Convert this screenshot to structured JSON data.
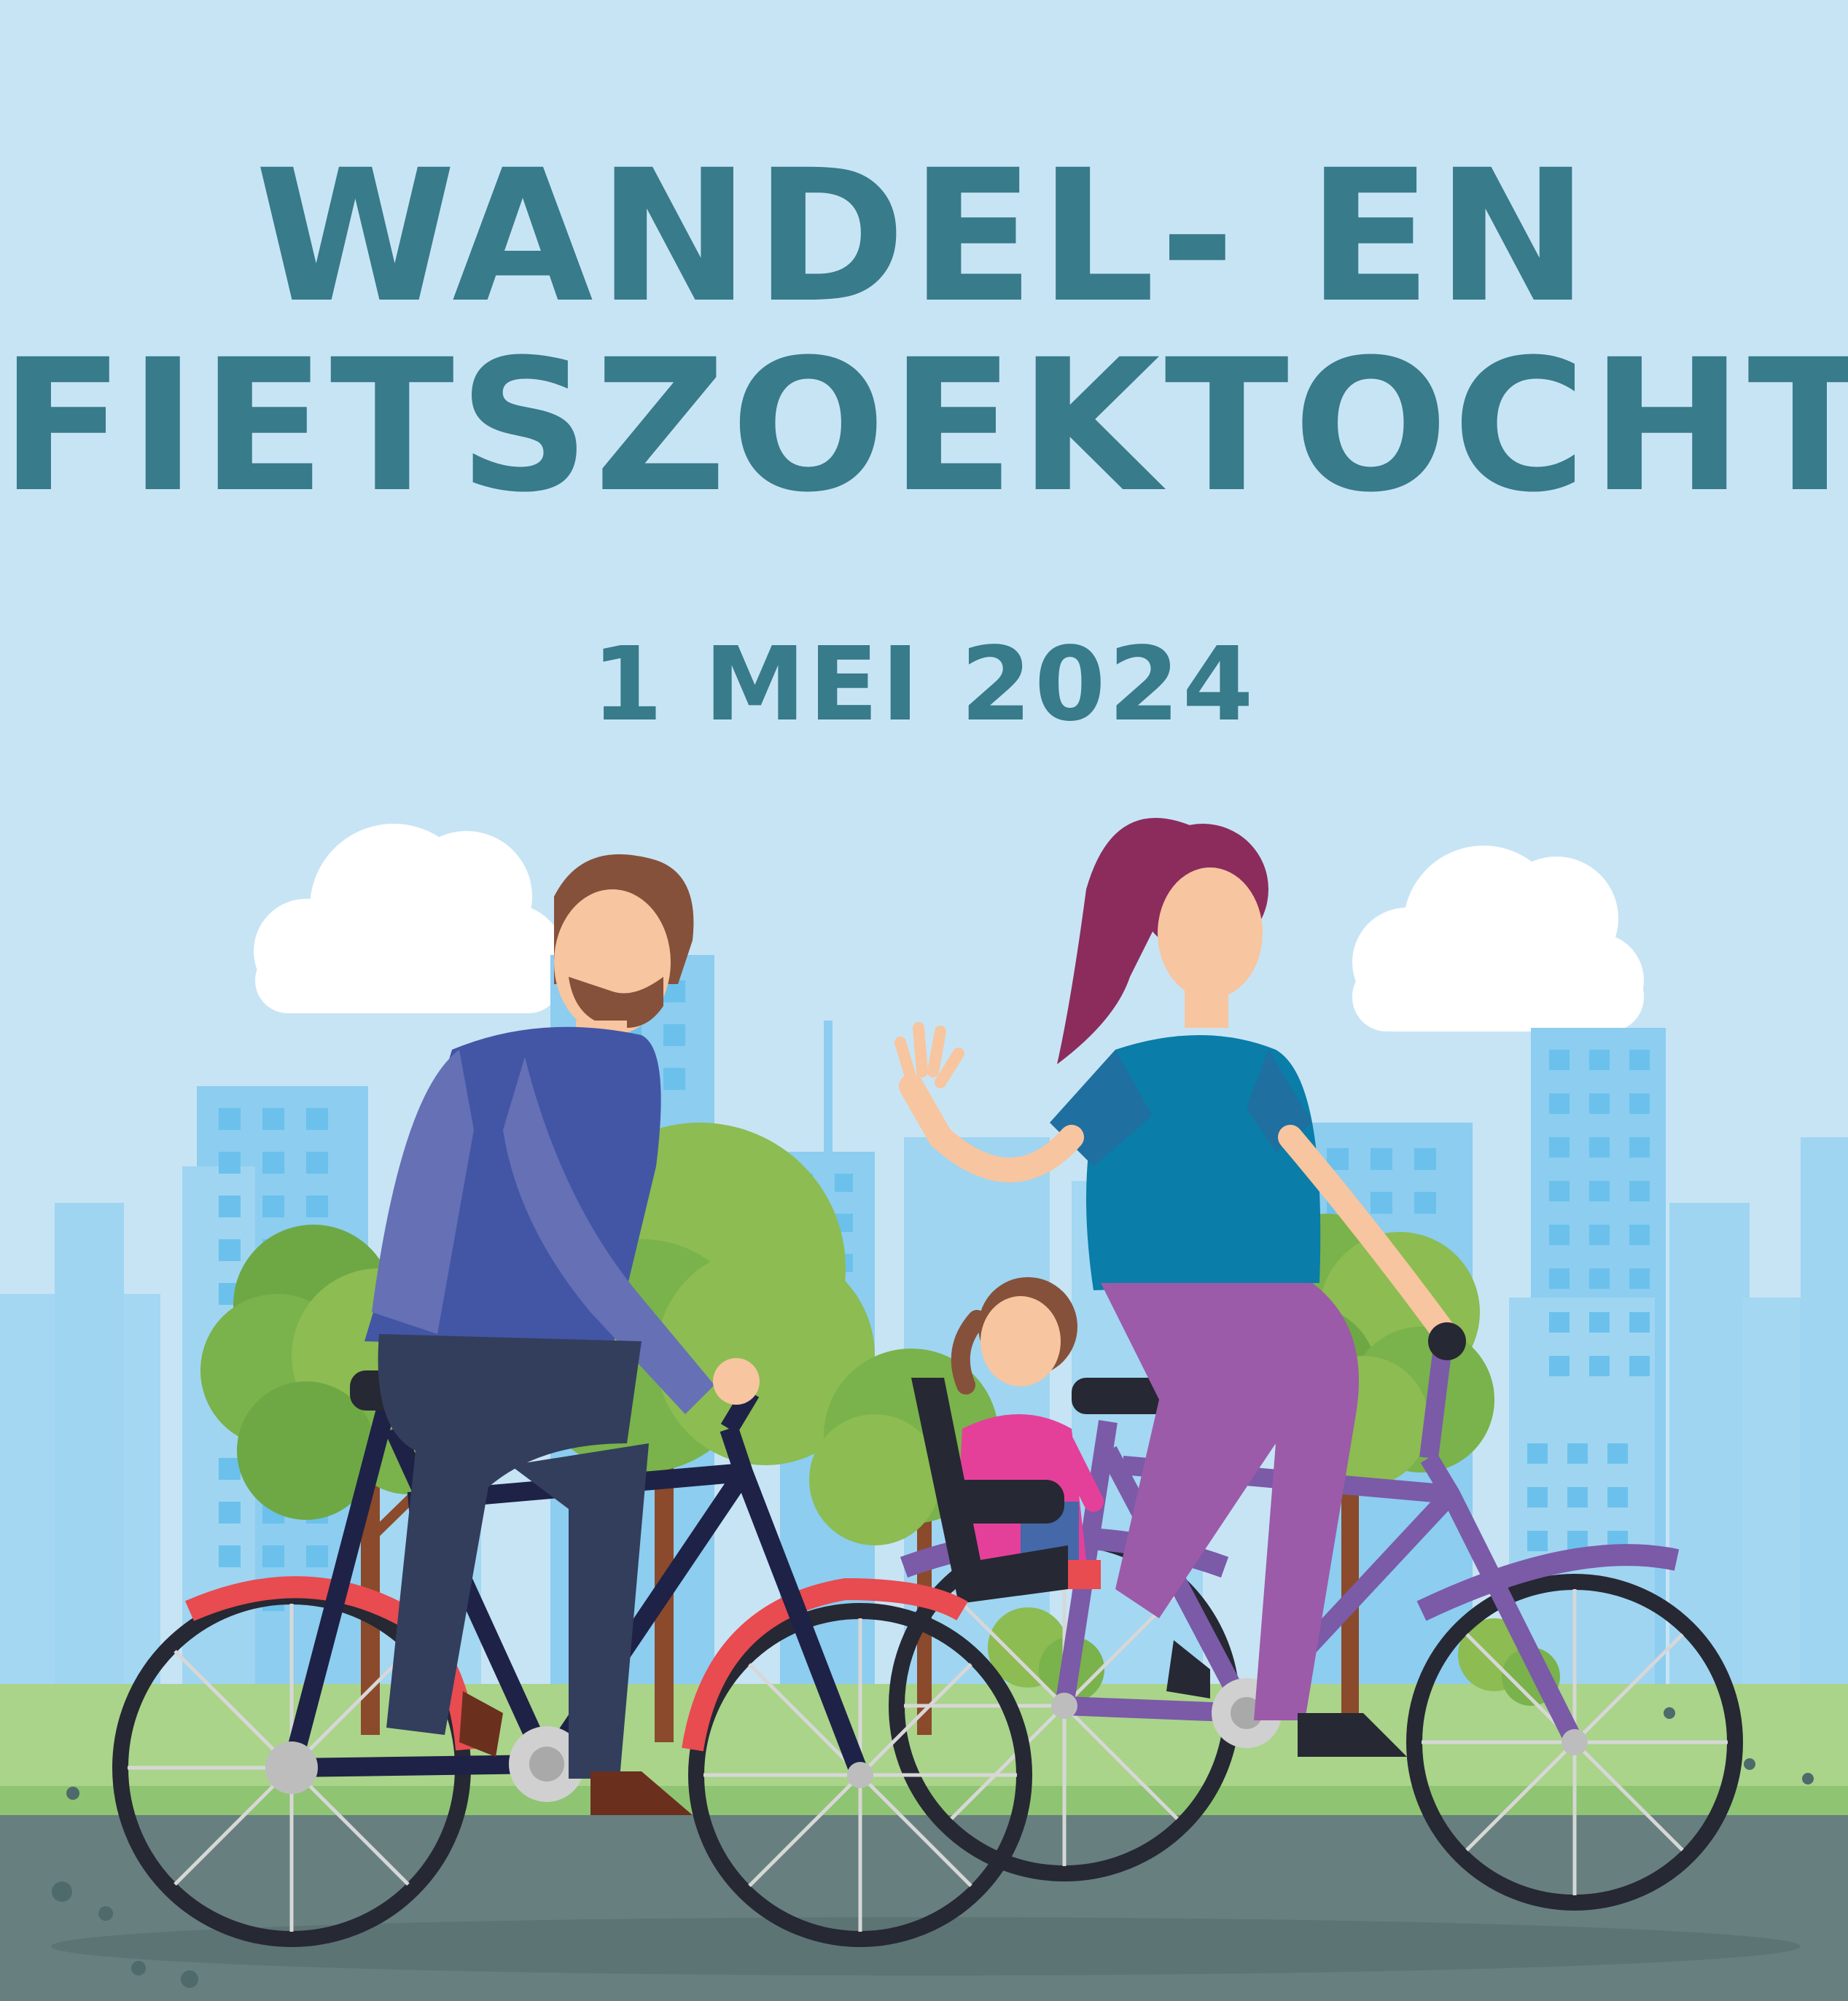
{
  "title": {
    "line1": "WANDEL- EN",
    "line2": "FIETSZOEKTOCHT"
  },
  "date": "1 MEI 2024",
  "colors": {
    "sky": "#c7e4f5",
    "title": "#387b8a",
    "building": "#9fd5f1",
    "building_window": "#6bc1ec",
    "grass": "#a9d48a",
    "road": "#677f7f",
    "tree": "#8cbc52",
    "bike_red": "#e84b50",
    "bike_navy": "#1e2246",
    "bike_purple": "#7b5aa8"
  }
}
